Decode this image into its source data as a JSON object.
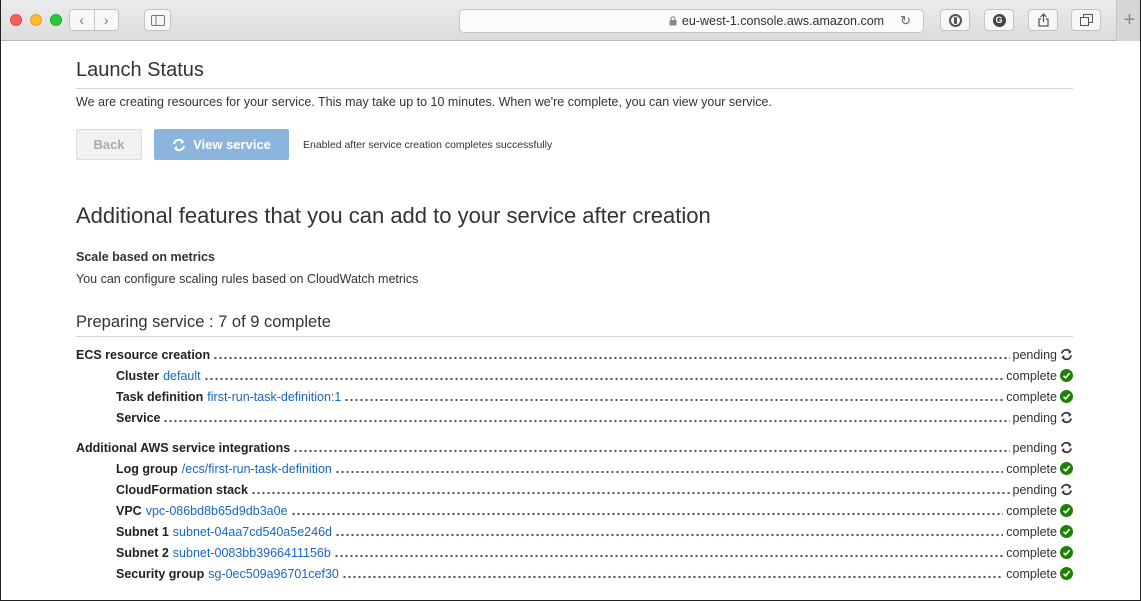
{
  "browser": {
    "url": "eu-west-1.console.aws.amazon.com",
    "nav_back": "‹",
    "nav_forward": "›",
    "new_tab": "+"
  },
  "launch": {
    "title": "Launch Status",
    "intro": "We are creating resources for your service. This may take up to 10 minutes. When we're complete, you can view your service.",
    "back_label": "Back",
    "view_label": "View service",
    "view_note": "Enabled after service creation completes successfully"
  },
  "features": {
    "title": "Additional features that you can add to your service after creation",
    "scale_title": "Scale based on metrics",
    "scale_desc": "You can configure scaling rules based on CloudWatch metrics"
  },
  "progress": {
    "title": "Preparing service : 7 of 9 complete",
    "colors": {
      "link": "#1a66c0",
      "complete": "#1d8102",
      "pending": "#333333"
    },
    "rows": [
      {
        "label": "ECS resource creation",
        "link": "",
        "status": "pending",
        "sub": false,
        "gap": false
      },
      {
        "label": "Cluster",
        "link": "default",
        "status": "complete",
        "sub": true,
        "gap": false
      },
      {
        "label": "Task definition",
        "link": "first-run-task-definition:1",
        "status": "complete",
        "sub": true,
        "gap": false
      },
      {
        "label": "Service",
        "link": "",
        "status": "pending",
        "sub": true,
        "gap": false
      },
      {
        "label": "Additional AWS service integrations",
        "link": "",
        "status": "pending",
        "sub": false,
        "gap": true
      },
      {
        "label": "Log group",
        "link": "/ecs/first-run-task-definition",
        "status": "complete",
        "sub": true,
        "gap": false
      },
      {
        "label": "CloudFormation stack",
        "link": "",
        "status": "pending",
        "sub": true,
        "gap": false
      },
      {
        "label": "VPC",
        "link": "vpc-086bd8b65d9db3a0e",
        "status": "complete",
        "sub": true,
        "gap": false
      },
      {
        "label": "Subnet 1",
        "link": "subnet-04aa7cd540a5e246d",
        "status": "complete",
        "sub": true,
        "gap": false
      },
      {
        "label": "Subnet 2",
        "link": "subnet-0083bb3966411156b",
        "status": "complete",
        "sub": true,
        "gap": false
      },
      {
        "label": "Security group",
        "link": "sg-0ec509a96701cef30",
        "status": "complete",
        "sub": true,
        "gap": false
      }
    ]
  }
}
